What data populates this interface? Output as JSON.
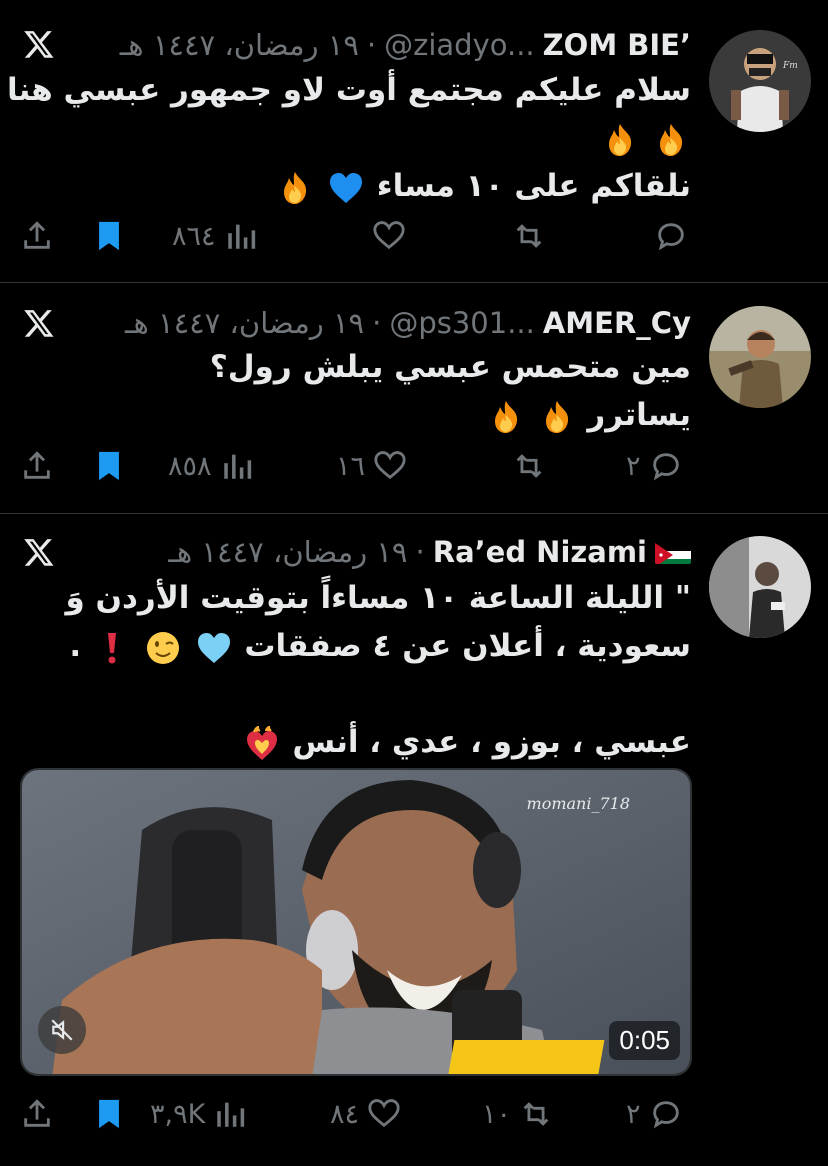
{
  "tweets": [
    {
      "name": "ZOM BIE’",
      "handle": "@ziadyo...",
      "date": "١٩ رمضان، ١٤٤٧ هـ",
      "body": [
        "سلام عليكم مجتمع أوت لاو  جمهور عبسي هنا",
        "",
        "نلقاكم على ١٠ مساء"
      ],
      "emojis": [
        "fire-emoji",
        "blue-heart-emoji"
      ],
      "views": "٨٦٤",
      "likes": "",
      "retweets": "",
      "replies": ""
    },
    {
      "name": "AMER_Cy",
      "handle": "@ps301...",
      "date": "١٩ رمضان، ١٤٤٧ هـ",
      "body": [
        "مين متحمس عبسي يبلش رول؟",
        "يساترر"
      ],
      "emojis": [
        "fire-emoji"
      ],
      "views": "٨٥٨",
      "likes": "١٦",
      "retweets": "",
      "replies": "٢"
    },
    {
      "name": "Ra’ed Nizami",
      "handle": "",
      "date": "١٩ رمضان، ١٤٤٧ هـ",
      "body": [
        "\" الليلة الساعة ١٠ مساءاً بتوقيت الأردن وَ",
        "سعودية ، أعلان عن ٤ صفقات",
        "عبسي ، بوزو ، عدي ، أنس"
      ],
      "emojis": [
        "light-blue-heart-emoji",
        "winking-face-emoji",
        "exclamation-emoji",
        "heart-on-fire-emoji",
        "jordan-flag-icon"
      ],
      "media": {
        "watermark": "momani_718",
        "duration": "0:05"
      },
      "views": "٣,٩K",
      "likes": "٨٤",
      "retweets": "١٠",
      "replies": "٢"
    }
  ],
  "colors": {
    "bg": "#000000",
    "text": "#e7e9ea",
    "muted": "#71767b",
    "bookmark": "#1d9bf0",
    "divider": "#2f3336"
  }
}
